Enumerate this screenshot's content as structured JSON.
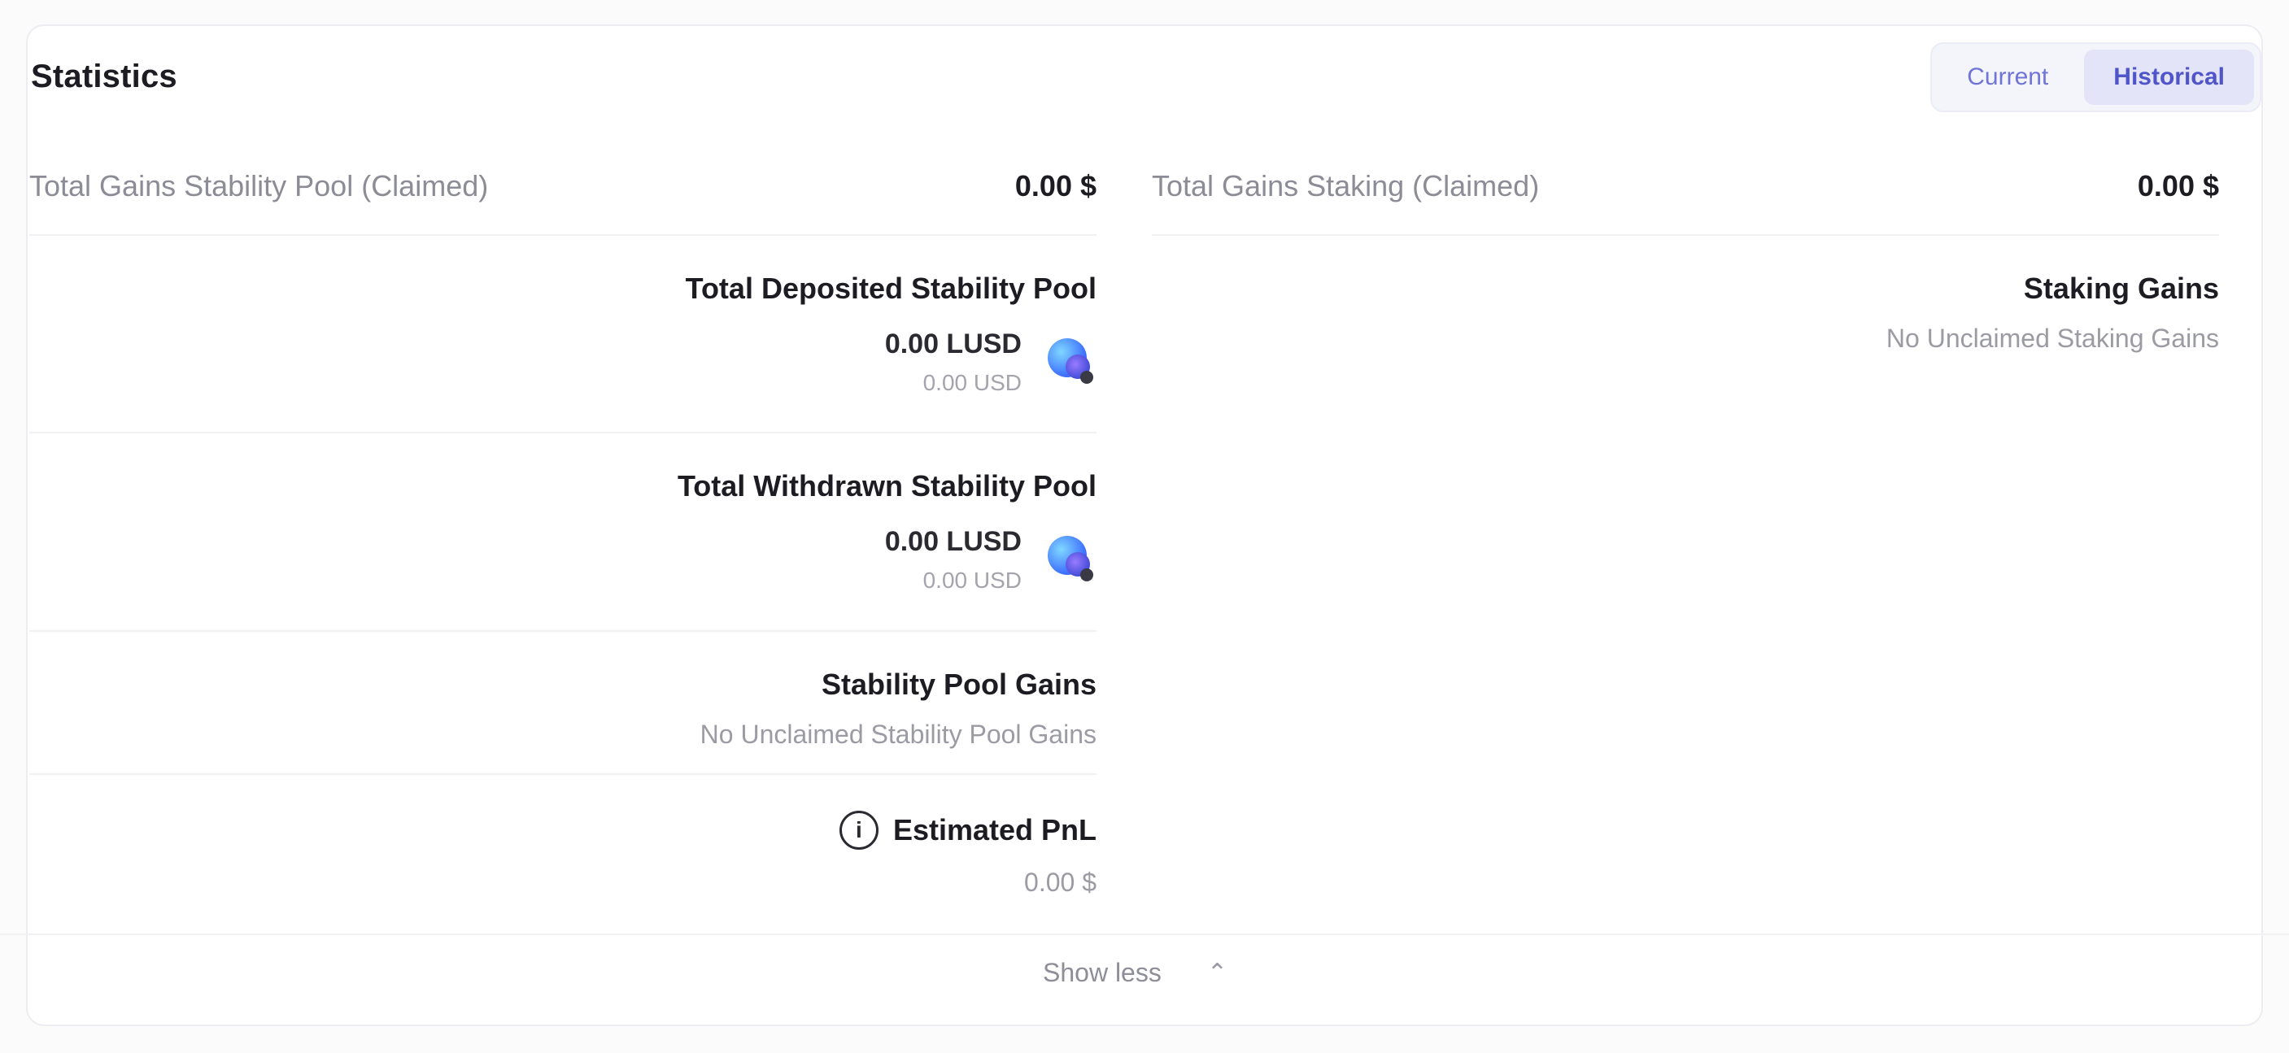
{
  "panel": {
    "title": "Statistics",
    "toggle": {
      "options": [
        "Current",
        "Historical"
      ],
      "selected": "Historical"
    }
  },
  "left": {
    "header": {
      "label": "Total Gains Stability Pool (Claimed)",
      "value": "0.00 $"
    },
    "deposited": {
      "label": "Total Deposited Stability Pool",
      "amount": "0.00 LUSD",
      "usd": "0.00 USD",
      "icon": "lusd-token-icon"
    },
    "withdrawn": {
      "label": "Total Withdrawn Stability Pool",
      "amount": "0.00 LUSD",
      "usd": "0.00 USD",
      "icon": "lusd-token-icon"
    },
    "pool_gains": {
      "label": "Stability Pool Gains",
      "value": "No Unclaimed Stability Pool Gains"
    },
    "unrealized_pnl": {
      "label": "Estimated PnL",
      "value": "0.00 $"
    }
  },
  "right": {
    "header": {
      "label": "Total Gains Staking (Claimed)",
      "value": "0.00 $"
    },
    "staking_gains": {
      "label": "Staking Gains",
      "value": "No Unclaimed Staking Gains"
    }
  },
  "footer": {
    "show_less": "Show less",
    "chevron": "chevron-up-icon"
  }
}
